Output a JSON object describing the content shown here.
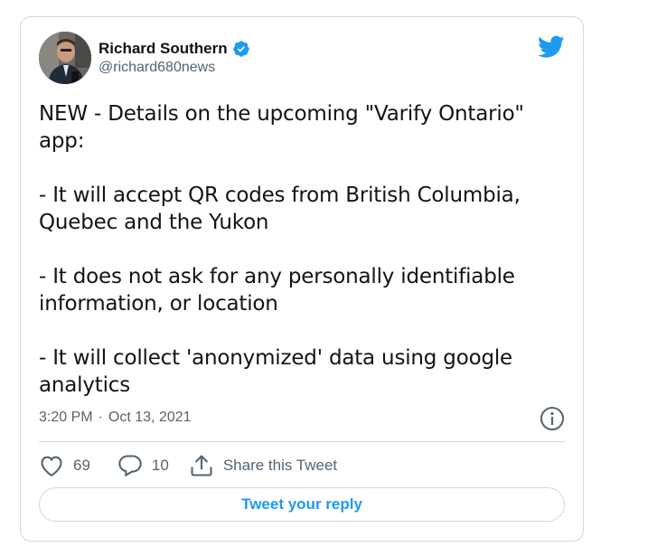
{
  "tweet": {
    "author": {
      "display_name": "Richard Southern",
      "handle": "@richard680news",
      "verified": true
    },
    "text": "NEW - Details on the upcoming \"Varify Ontario\" app:\n\n- It will accept QR codes from British Columbia, Quebec and the Yukon\n\n- It does not ask for any personally identifiable information, or location\n\n- It will collect 'anonymized' data using google analytics",
    "time": "3:20 PM",
    "separator": "·",
    "date": "Oct 13, 2021",
    "likes": "69",
    "replies": "10",
    "share_label": "Share this Tweet",
    "reply_button_label": "Tweet your reply"
  },
  "icons": {
    "brand": "twitter-bird-icon",
    "verified": "verified-badge-icon",
    "info": "info-icon",
    "like": "heart-icon",
    "reply": "comment-icon",
    "share": "share-icon"
  },
  "colors": {
    "accent": "#1d9bf0",
    "text": "#0f1419",
    "secondary": "#536471",
    "border": "#cfd9de"
  }
}
